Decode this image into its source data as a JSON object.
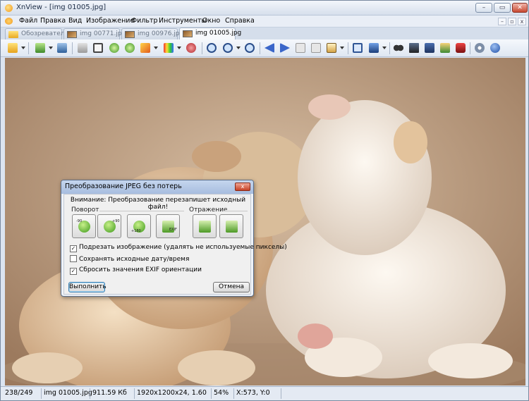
{
  "window": {
    "title": "XnView - [img 01005.jpg]",
    "controls": {
      "minimize": "–",
      "maximize": "▭",
      "close": "✕"
    }
  },
  "menu": {
    "items": [
      "Файл",
      "Правка",
      "Вид",
      "Изображение",
      "Фильтр",
      "Инструменты",
      "Окно",
      "Справка"
    ],
    "mdi_controls": {
      "minimize": "–",
      "restore": "▫",
      "close": "x"
    }
  },
  "tabs": [
    {
      "label": "Обозреватель",
      "icon": "folder-icon",
      "active": false
    },
    {
      "label": "img 00771.jpg",
      "icon": "image-thumb-icon",
      "active": false
    },
    {
      "label": "img 00976.jpg",
      "icon": "image-thumb-icon",
      "active": false
    },
    {
      "label": "img 01005.jpg",
      "icon": "image-thumb-icon",
      "active": true
    }
  ],
  "toolbar": {
    "icons": [
      "browser-icon",
      "open-folder-icon",
      "save-icon",
      "print-icon",
      "crop-icon",
      "rotate-left-icon",
      "rotate-right-icon",
      "adjust-icon",
      "effects-icon",
      "badge-icon",
      "zoom-in-icon",
      "zoom-icon",
      "zoom-out-icon",
      "previous-icon",
      "next-icon",
      "first-icon",
      "last-icon",
      "slideshow-icon",
      "fullscreen-icon",
      "screen-icon",
      "binoculars-icon",
      "scanner-icon",
      "filmstrip-icon",
      "capture-icon",
      "settings-icon",
      "info-icon"
    ]
  },
  "status": {
    "index": "238/249",
    "filename": "img 01005.jpg",
    "filesize": "911.59 Кб",
    "dimensions": "1920x1200x24, 1.60",
    "zoom": "54%",
    "coords": "X:573, Y:0"
  },
  "dialog": {
    "title": "Преобразование JPEG без потерь",
    "close": "x",
    "warning": "Внимание: Преобразование перезапишет исходный файл!",
    "rotation_group": "Поворот",
    "rotation_buttons": [
      {
        "tag": "-90"
      },
      {
        "tag": "+90"
      },
      {
        "tag": "+180"
      },
      {
        "tag": "EXIF"
      }
    ],
    "mirror_group": "Отражение",
    "checkboxes": [
      {
        "label": "Подрезать изображение (удалять не используемые пикселы)",
        "checked": true
      },
      {
        "label": "Сохранять исходные дату/время",
        "checked": false
      },
      {
        "label": "Сбросить значения EXIF ориентации",
        "checked": true
      }
    ],
    "ok_button": "Выполнить",
    "cancel_button": "Отмена"
  },
  "colors": {
    "titlebar": "#d6dfec",
    "accent": "#3c7fb1",
    "close_button": "#c84a32",
    "photo_background": "#b8977a"
  }
}
